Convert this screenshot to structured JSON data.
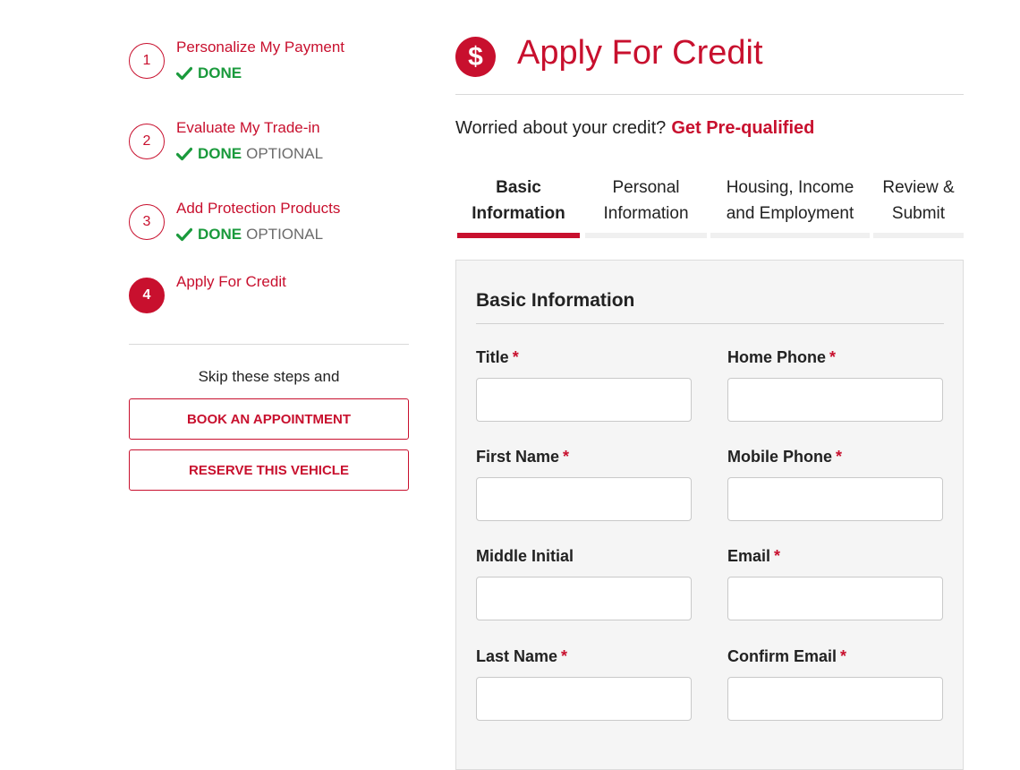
{
  "steps": [
    {
      "number": "1",
      "title": "Personalize My Payment",
      "status": "DONE",
      "optional": ""
    },
    {
      "number": "2",
      "title": "Evaluate My Trade-in",
      "status": "DONE",
      "optional": "OPTIONAL"
    },
    {
      "number": "3",
      "title": "Add Protection Products",
      "status": "DONE",
      "optional": "OPTIONAL"
    },
    {
      "number": "4",
      "title": "Apply For Credit",
      "status": "",
      "optional": ""
    }
  ],
  "sidebar": {
    "skip_text": "Skip these steps and",
    "book_label": "BOOK AN APPOINTMENT",
    "reserve_label": "RESERVE THIS VEHICLE"
  },
  "header": {
    "icon_symbol": "$",
    "title": "Apply For Credit"
  },
  "credit": {
    "question": "Worried about your credit?",
    "link": "Get Pre-qualified"
  },
  "tabs": [
    {
      "line1": "Basic",
      "line2": "Information",
      "active": true
    },
    {
      "line1": "Personal",
      "line2": "Information",
      "active": false
    },
    {
      "line1": "Housing, Income",
      "line2": "and Employment",
      "active": false
    },
    {
      "line1": "Review &",
      "line2": "Submit",
      "active": false
    }
  ],
  "form": {
    "title": "Basic Information",
    "fields": {
      "title": {
        "label": "Title",
        "value": "",
        "required": "*"
      },
      "home_phone": {
        "label": "Home Phone",
        "value": "",
        "required": "*"
      },
      "first_name": {
        "label": "First Name",
        "value": "",
        "required": "*"
      },
      "mobile_phone": {
        "label": "Mobile Phone",
        "value": "",
        "required": "*"
      },
      "middle_initial": {
        "label": "Middle Initial",
        "value": ""
      },
      "email": {
        "label": "Email",
        "value": "",
        "required": "*"
      },
      "last_name": {
        "label": "Last Name",
        "value": "",
        "required": "*"
      },
      "confirm_email": {
        "label": "Confirm Email",
        "value": "",
        "required": "*"
      }
    }
  },
  "colors": {
    "brand_red": "#c8102e",
    "done_green": "#1a9a3c",
    "optional_gray": "#6b6b6b",
    "panel_bg": "#f5f5f5"
  },
  "icons": [
    "check-icon",
    "dollar-icon",
    "select-arrows-icon"
  ]
}
